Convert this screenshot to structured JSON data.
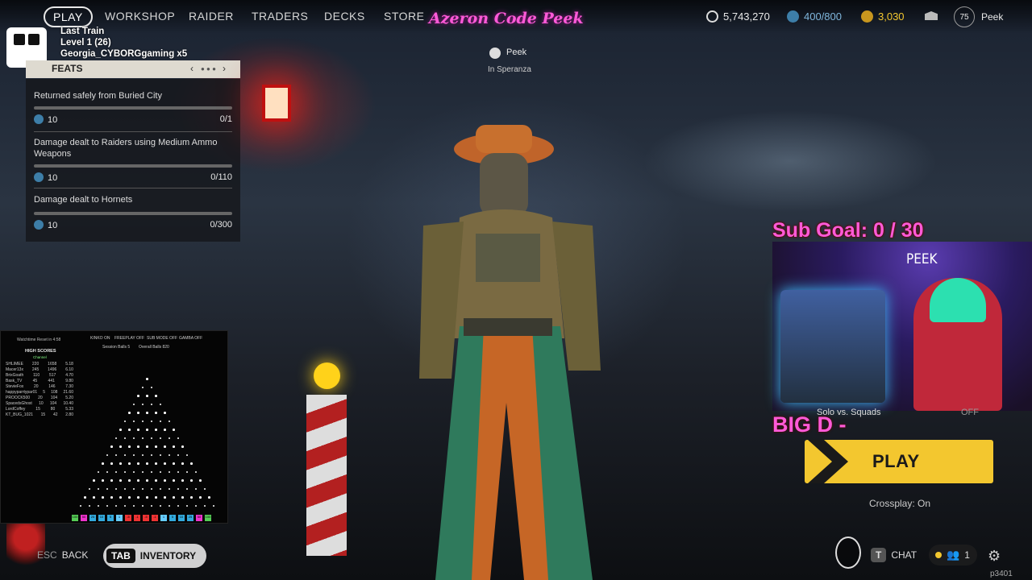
{
  "nav": {
    "items": [
      "PLAY",
      "WORKSHOP",
      "RAIDER",
      "TRADERS",
      "DECKS",
      "STORE"
    ],
    "overlay_title": "Azeron Code Peek"
  },
  "currencies": {
    "credits": "5,743,270",
    "tokens": "400/800",
    "coins": "3,030"
  },
  "profile": {
    "level": "75",
    "name": "Peek"
  },
  "train": {
    "line1": "Last Train",
    "line2": "Level 1  (26)",
    "line3": "Georgia_CYBORGgaming x5"
  },
  "player": {
    "name": "Peek",
    "location": "In Speranza"
  },
  "feats": {
    "title": "FEATS",
    "items": [
      {
        "name": "Returned safely from Buried City",
        "reward": "10",
        "progress": "0/1"
      },
      {
        "name": "Damage dealt to Raiders using Medium Ammo Weapons",
        "reward": "10",
        "progress": "0/110"
      },
      {
        "name": "Damage dealt to Hornets",
        "reward": "10",
        "progress": "0/300"
      }
    ]
  },
  "plinko": {
    "title": "Watchtime Reset in 4:58",
    "high_scores": "HIGH SCORES",
    "channel": "Channel",
    "stats": [
      "KINKO ON",
      "FREEPLAY OFF",
      "SUB MODE OFF",
      "GAMBA OFF"
    ],
    "session_balls": "Session Balls  5",
    "overall_balls": "Overall Balls  820",
    "rows": [
      [
        "SHLIMEE",
        "220",
        "1658",
        "5.18"
      ],
      [
        "Macer13x",
        "245",
        "1496",
        "6.10"
      ],
      [
        "BrixGoath",
        "110",
        "517",
        "4.70"
      ],
      [
        "Bask_TV",
        "45",
        "441",
        "9.80"
      ],
      [
        "StevieFox",
        "20",
        "146",
        "7.30"
      ],
      [
        "happyparrtypar01",
        "5",
        "108",
        "21.60"
      ],
      [
        "PROOCK500",
        "20",
        "104",
        "5.20"
      ],
      [
        "SpacedsGhost",
        "10",
        "104",
        "10.40"
      ],
      [
        "LordCoffey",
        "15",
        "80",
        "5.33"
      ],
      [
        "KT_BUG_1021",
        "15",
        "42",
        "2.80"
      ]
    ],
    "buckets": [
      "100",
      "50",
      "25",
      "10",
      "5",
      "1",
      "-5",
      "-1",
      "-5",
      "-1",
      "1",
      "5",
      "10",
      "25",
      "50",
      "100"
    ]
  },
  "stream": {
    "sub_goal": "Sub Goal:  0 / 30",
    "cam_name": "PEEK",
    "big_d": "BIG D -"
  },
  "matchmaking": {
    "mode_label": "Solo vs. Squads",
    "mode_value": "OFF",
    "play_label": "PLAY",
    "crossplay": "Crossplay: On"
  },
  "bottom": {
    "back_key": "ESC",
    "back_label": "BACK",
    "tab_key": "TAB",
    "inventory_label": "INVENTORY",
    "chat_key": "T",
    "chat_label": "CHAT",
    "party_count": "1",
    "build": "p3401"
  },
  "colors": {
    "accent": "#f3c72f",
    "overlay_pink": "#ff5ad8"
  }
}
